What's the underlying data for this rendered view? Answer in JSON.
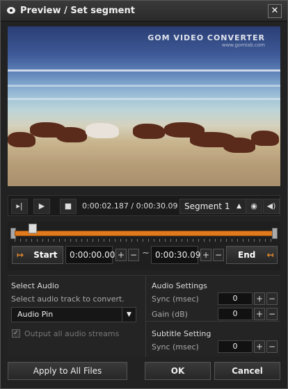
{
  "window": {
    "title": "Preview / Set segment",
    "close_label": "✕"
  },
  "video": {
    "watermark": "GOM VIDEO CONVERTER",
    "watermark_sub": "www.gomlab.com"
  },
  "controls": {
    "timecode": "0:00:02.187 / 0:00:30.09",
    "segment_label": "Segment 1",
    "icons": [
      "step-icon",
      "play-icon",
      "stop-icon",
      "camera-icon",
      "volume-icon"
    ]
  },
  "segment": {
    "start_label": "Start",
    "end_label": "End",
    "start_time": "0:00:00.00",
    "end_time": "0:00:30.09",
    "tilde": "~",
    "plus": "+",
    "minus": "−",
    "start_position": 0.07
  },
  "audio": {
    "heading": "Select Audio",
    "hint": "Select audio track to convert.",
    "selected": "Audio Pin",
    "output_all_label": "Output all audio streams"
  },
  "audio_settings": {
    "heading": "Audio Settings",
    "sync_label": "Sync (msec)",
    "sync_value": "0",
    "gain_label": "Gain (dB)",
    "gain_value": "0"
  },
  "subtitle_settings": {
    "heading": "Subtitle Setting",
    "sync_label": "Sync (msec)",
    "sync_value": "0"
  },
  "buttons": {
    "apply_all": "Apply to All Files",
    "ok": "OK",
    "cancel": "Cancel"
  },
  "colors": {
    "accent": "#e17a1c",
    "background": "#222222"
  }
}
